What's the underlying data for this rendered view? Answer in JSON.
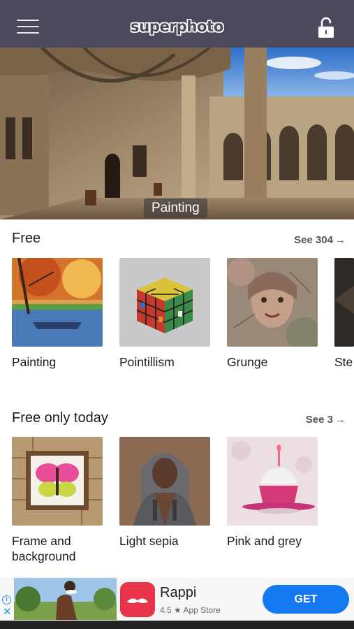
{
  "header": {
    "logo_text": "superphoto",
    "menu_icon": "hamburger-menu-icon",
    "lock_icon": "unlock-icon"
  },
  "hero": {
    "label": "Painting"
  },
  "sections": [
    {
      "title": "Free",
      "see_all": "See 304",
      "arrow": "→",
      "items": [
        {
          "label": "Painting"
        },
        {
          "label": "Pointillism"
        },
        {
          "label": "Grunge"
        },
        {
          "label": "Ste"
        }
      ]
    },
    {
      "title": "Free only today",
      "see_all": "See 3",
      "arrow": "→",
      "items": [
        {
          "label": "Frame and background"
        },
        {
          "label": "Light sepia"
        },
        {
          "label": "Pink and grey"
        }
      ]
    }
  ],
  "ad": {
    "app_name": "Rappi",
    "rating": "4.5 ★ App Store",
    "cta": "GET",
    "info_icon": "i",
    "close_icon": "✕"
  },
  "colors": {
    "header_bg": "#4a4a5c",
    "get_button": "#1478f0",
    "app_icon": "#e8334a"
  }
}
